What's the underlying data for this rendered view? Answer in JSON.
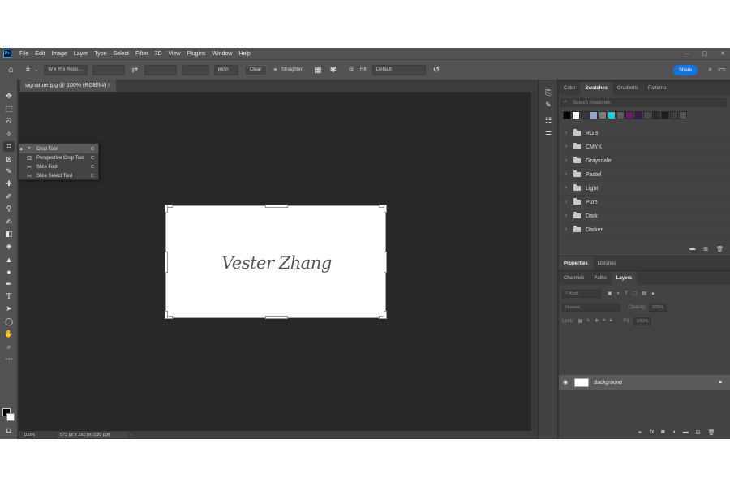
{
  "app": {
    "logo": "Ps",
    "menus": [
      "File",
      "Edit",
      "Image",
      "Layer",
      "Type",
      "Select",
      "Filter",
      "3D",
      "View",
      "Plugins",
      "Window",
      "Help"
    ],
    "window_controls": [
      "—",
      "▢",
      "✕"
    ]
  },
  "options": {
    "ratio_select": "W x H x Reso...",
    "units": "px/in",
    "clear_label": "Clear",
    "straighten_label": "Straighten",
    "fill_label": "Fill:",
    "fill_value": "Default",
    "share_label": "Share"
  },
  "document": {
    "tab_title": "signature.jpg @ 100% (RGB/8#)",
    "signature_text": "Vester Zhang",
    "zoom": "100%",
    "dimensions": "573 px x 291 px (120 ppi)"
  },
  "flyout": {
    "items": [
      {
        "label": "Crop Tool",
        "key": "C",
        "selected": true
      },
      {
        "label": "Perspective Crop Tool",
        "key": "C",
        "selected": false
      },
      {
        "label": "Slice Tool",
        "key": "C",
        "selected": false
      },
      {
        "label": "Slice Select Tool",
        "key": "C",
        "selected": false
      }
    ]
  },
  "swatches_panel": {
    "tabs": [
      "Color",
      "Swatches",
      "Gradients",
      "Patterns"
    ],
    "active_tab": "Swatches",
    "search_placeholder": "Search Swatches",
    "recent_colors": [
      "#000000",
      "#ffffff",
      "#3a3a3a",
      "#8fa7c7",
      "#7a7a7a",
      "#26c6da",
      "#5a5a5a",
      "#6a1b6a",
      "#3c1a50",
      "#4a4a4a",
      "#2c2c2c",
      "#1e1e1e",
      "#3e3e3e",
      "#555555"
    ],
    "groups": [
      "RGB",
      "CMYK",
      "Grayscale",
      "Pastel",
      "Light",
      "Pure",
      "Dark",
      "Darker"
    ]
  },
  "properties_panel": {
    "tabs": [
      "Properties",
      "Libraries"
    ],
    "active_tab": "Properties"
  },
  "layers_panel": {
    "tabs": [
      "Channels",
      "Paths",
      "Layers"
    ],
    "active_tab": "Layers",
    "filter_label": "Kind",
    "blend_mode": "Normal",
    "opacity_label": "Opacity:",
    "opacity_value": "100%",
    "lock_label": "Lock:",
    "fill_label": "Fill:",
    "fill_value": "100%",
    "layers": [
      {
        "name": "Background",
        "visible": true,
        "locked": true
      }
    ]
  }
}
